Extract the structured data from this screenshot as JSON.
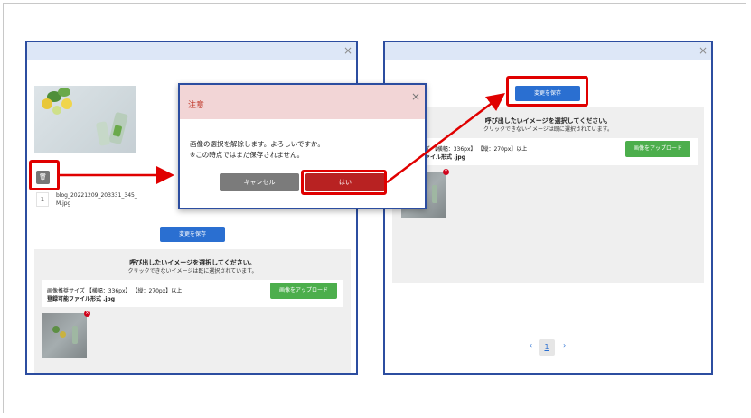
{
  "colors": {
    "panel_border": "#2c4da0",
    "accent_blue": "#2a6fd1",
    "upload_green": "#4cae4c",
    "danger_red": "#c0392b",
    "highlight_red": "#e00000"
  },
  "left_panel": {
    "close_icon": "×",
    "trash_icon": "🗑",
    "file": {
      "index": "1",
      "name": "blog_20221209_203331_345_M.jpg"
    },
    "save_label": "変更を保存",
    "section": {
      "title": "呼び出したいイメージを選択してください。",
      "subtitle": "クリックできないイメージは既に選択されています。",
      "size_line": "画像推奨サイズ 【横幅：336px】 【縦：270px】以上",
      "format_line": "登録可能ファイル形式 .jpg",
      "upload_label": "画像をアップロード",
      "remove_icon": "×"
    }
  },
  "dialog": {
    "title": "注意",
    "close_icon": "×",
    "message_1": "画像の選択を解除します。よろしいですか。",
    "message_2": "※この時点ではまだ保存されません。",
    "cancel_label": "キャンセル",
    "confirm_label": "はい"
  },
  "right_panel": {
    "close_icon": "×",
    "save_label": "変更を保存",
    "section": {
      "title": "呼び出したいイメージを選択してください。",
      "subtitle": "クリックできないイメージは既に選択されています。",
      "size_line": "推奨サイズ 【横幅：336px】 【縦：270px】以上",
      "format_line": "録可能ファイル形式 .jpg",
      "upload_label": "画像をアップロード",
      "remove_icon": "×"
    },
    "pagination": {
      "prev": "‹",
      "current": "1",
      "next": "›"
    }
  }
}
